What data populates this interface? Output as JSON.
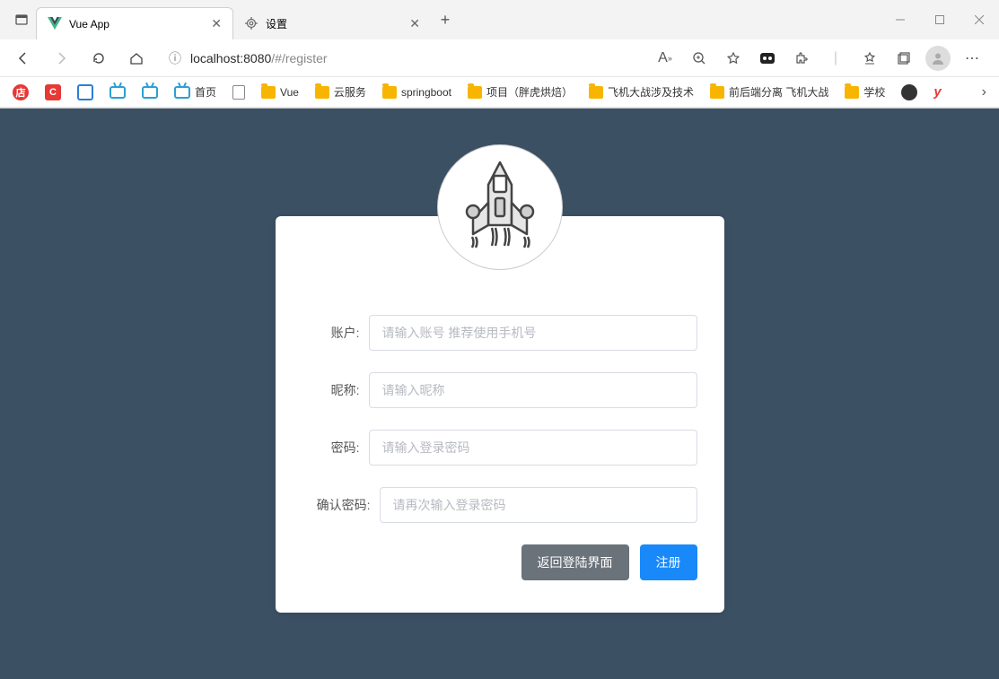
{
  "browser": {
    "tabs": [
      {
        "title": "Vue App",
        "active": true
      },
      {
        "title": "设置",
        "active": false
      }
    ],
    "url_host": "localhost:8080",
    "url_path": "/#/register"
  },
  "bookmarks": {
    "items": [
      {
        "label": "首页",
        "icon": "home"
      },
      {
        "label": "",
        "icon": "file"
      },
      {
        "label": "Vue",
        "icon": "folder"
      },
      {
        "label": "云服务",
        "icon": "folder"
      },
      {
        "label": "springboot",
        "icon": "folder"
      },
      {
        "label": "项目（胖虎烘焙）",
        "icon": "folder"
      },
      {
        "label": "飞机大战涉及技术",
        "icon": "folder"
      },
      {
        "label": "前后端分离 飞机大战",
        "icon": "folder"
      },
      {
        "label": "学校",
        "icon": "folder"
      }
    ]
  },
  "form": {
    "account": {
      "label": "账户:",
      "placeholder": "请输入账号 推荐使用手机号",
      "value": ""
    },
    "nickname": {
      "label": "昵称:",
      "placeholder": "请输入昵称",
      "value": ""
    },
    "password": {
      "label": "密码:",
      "placeholder": "请输入登录密码",
      "value": ""
    },
    "confirm": {
      "label": "确认密码:",
      "placeholder": "请再次输入登录密码",
      "value": ""
    },
    "buttons": {
      "back": "返回登陆界面",
      "register": "注册"
    }
  }
}
